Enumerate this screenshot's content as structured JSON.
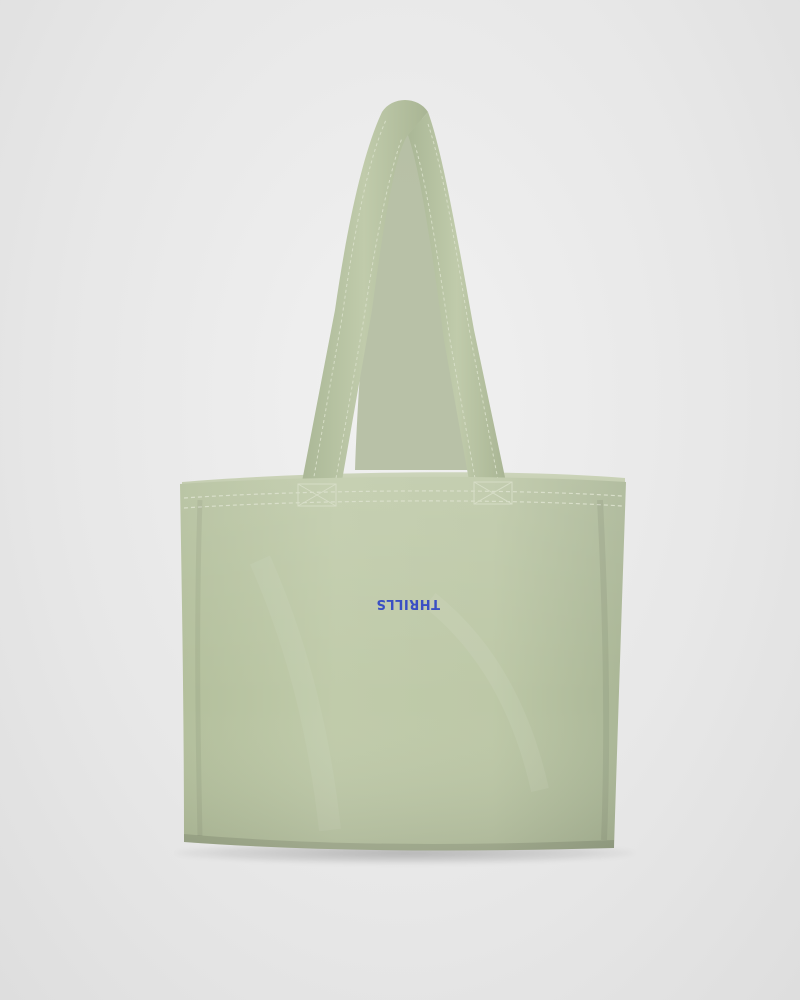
{
  "product": {
    "brand_label": "THRILLS",
    "brand_color": "#3a4fc4",
    "fabric_color": "#bcc8a6",
    "fabric_shadow_color": "#a8b592",
    "inner_color": "#c9d2b6",
    "background_color": "#ececec"
  }
}
